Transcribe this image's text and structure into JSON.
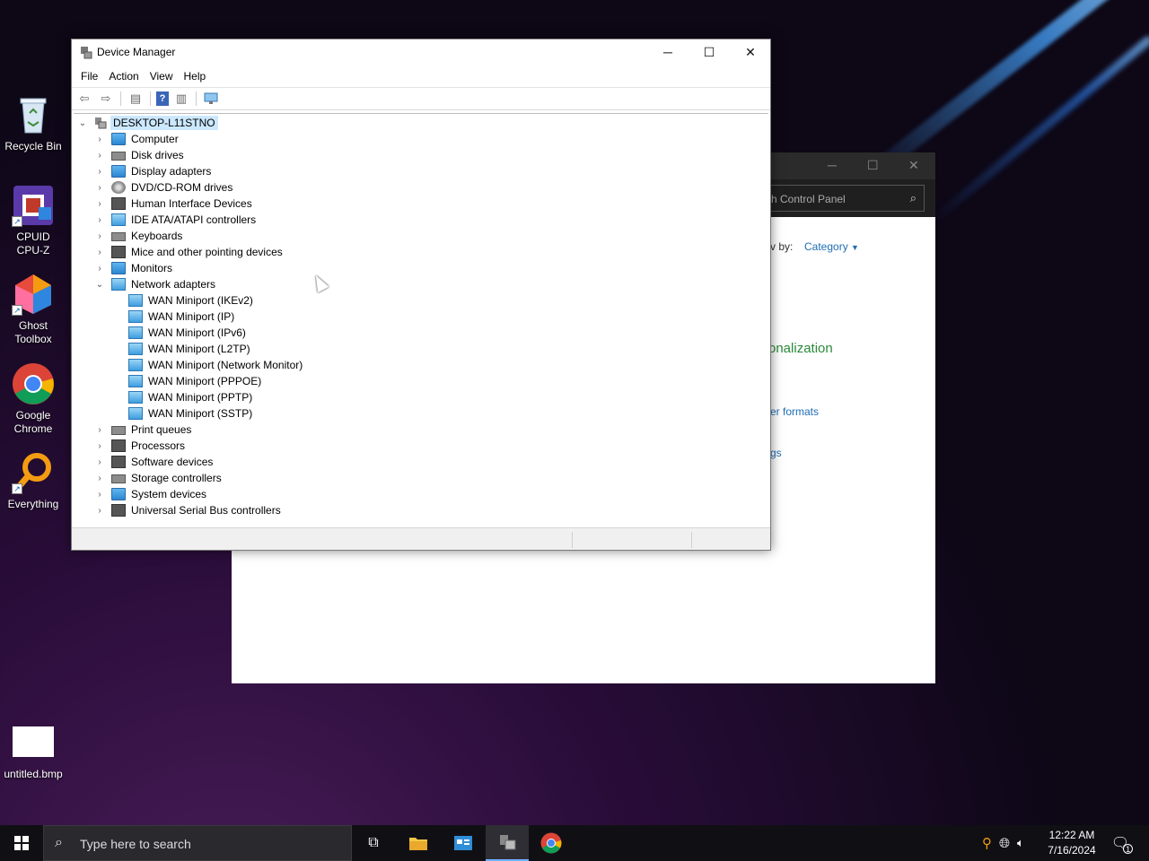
{
  "desktop": {
    "icons": [
      {
        "label": "Recycle Bin"
      },
      {
        "label": "CPUID\nCPU-Z"
      },
      {
        "label": "Ghost\nToolbox"
      },
      {
        "label": "Google\nChrome"
      },
      {
        "label": "Everything"
      },
      {
        "label": "untitled.bmp"
      }
    ]
  },
  "control_panel": {
    "search_placeholder": "ch Control Panel",
    "view_by_label": "v by:",
    "view_by_value": "Category",
    "link_personalization": "onalization",
    "link_formats": "er formats",
    "link_gs": "gs"
  },
  "device_manager": {
    "title": "Device Manager",
    "menu": [
      "File",
      "Action",
      "View",
      "Help"
    ],
    "root": "DESKTOP-L11STNO",
    "categories": [
      "Computer",
      "Disk drives",
      "Display adapters",
      "DVD/CD-ROM drives",
      "Human Interface Devices",
      "IDE ATA/ATAPI controllers",
      "Keyboards",
      "Mice and other pointing devices",
      "Monitors",
      "Network adapters"
    ],
    "network_adapters": [
      "WAN Miniport (IKEv2)",
      "WAN Miniport (IP)",
      "WAN Miniport (IPv6)",
      "WAN Miniport (L2TP)",
      "WAN Miniport (Network Monitor)",
      "WAN Miniport (PPPOE)",
      "WAN Miniport (PPTP)",
      "WAN Miniport (SSTP)"
    ],
    "categories_after": [
      "Print queues",
      "Processors",
      "Software devices",
      "Storage controllers",
      "System devices",
      "Universal Serial Bus controllers"
    ]
  },
  "taskbar": {
    "search_placeholder": "Type here to search",
    "time": "12:22 AM",
    "date": "7/16/2024",
    "notification_count": "1"
  }
}
